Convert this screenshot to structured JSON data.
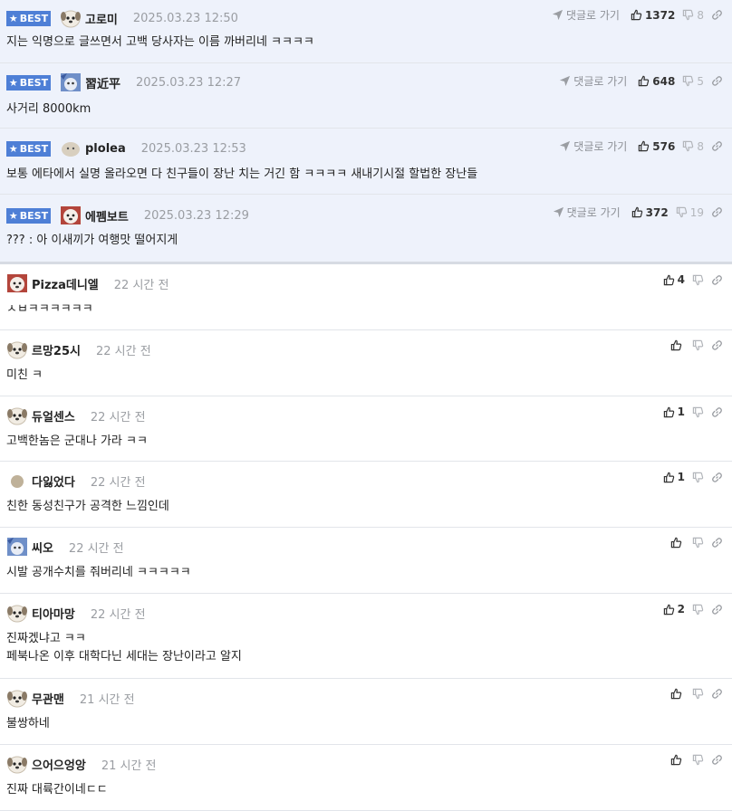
{
  "ui": {
    "best_label": "BEST",
    "reply_label": "댓글로 가기"
  },
  "best_comments": [
    {
      "author": "고로미",
      "time": "2025.03.23 12:50",
      "text": "지는 익명으로 글쓰면서 고백 당사자는 이름 까버리네 ㅋㅋㅋㅋ",
      "up": "1372",
      "down": "8",
      "avatar": "dog-avatar"
    },
    {
      "author": "習近平",
      "time": "2025.03.23 12:27",
      "text": "사거리 8000km",
      "up": "648",
      "down": "5",
      "avatar": "photo-avatar"
    },
    {
      "author": "plolea",
      "time": "2025.03.23 12:53",
      "text": "보통 에타에서 실명 올라오면 다 친구들이 장난 치는 거긴 함 ㅋㅋㅋㅋ 새내기시절 할법한 장난들",
      "up": "576",
      "down": "8",
      "avatar": "blob-avatar"
    },
    {
      "author": "에펨보트",
      "time": "2025.03.23 12:29",
      "text": "??? : 아 이새끼가 여행맛 떨어지게",
      "up": "372",
      "down": "19",
      "avatar": "bear-avatar"
    }
  ],
  "comments": [
    {
      "author": "Pizza데니엘",
      "time": "22 시간 전",
      "lines": [
        "ㅅㅂㅋㅋㅋㅋㅋㅋ"
      ],
      "up": "4",
      "avatar": "bear-avatar"
    },
    {
      "author": "르망25시",
      "time": "22 시간 전",
      "lines": [
        "미친 ㅋ"
      ],
      "up": "",
      "avatar": "dog-avatar"
    },
    {
      "author": "듀얼센스",
      "time": "22 시간 전",
      "lines": [
        "고백한놈은 군대나 가라 ㅋㅋ"
      ],
      "up": "1",
      "avatar": "dog-avatar"
    },
    {
      "author": "다잃었다",
      "time": "22 시간 전",
      "lines": [
        "친한 동성친구가 공격한 느낌인데"
      ],
      "up": "1",
      "avatar": "circle-avatar"
    },
    {
      "author": "씨오",
      "time": "22 시간 전",
      "lines": [
        "시발 공개수치를 줘버리네 ㅋㅋㅋㅋㅋ"
      ],
      "up": "",
      "avatar": "photo-avatar"
    },
    {
      "author": "티아마망",
      "time": "22 시간 전",
      "lines": [
        "진짜겠냐고 ㅋㅋ",
        "페북나온 이후 대학다닌 세대는 장난이라고 알지"
      ],
      "up": "2",
      "avatar": "dog-avatar"
    },
    {
      "author": "무관맨",
      "time": "21 시간 전",
      "lines": [
        "불쌍하네"
      ],
      "up": "",
      "avatar": "dog-avatar"
    },
    {
      "author": "으어으엉앙",
      "time": "21 시간 전",
      "lines": [
        "진짜 대륙간이네ㄷㄷ"
      ],
      "up": "",
      "avatar": "dog-avatar"
    }
  ]
}
